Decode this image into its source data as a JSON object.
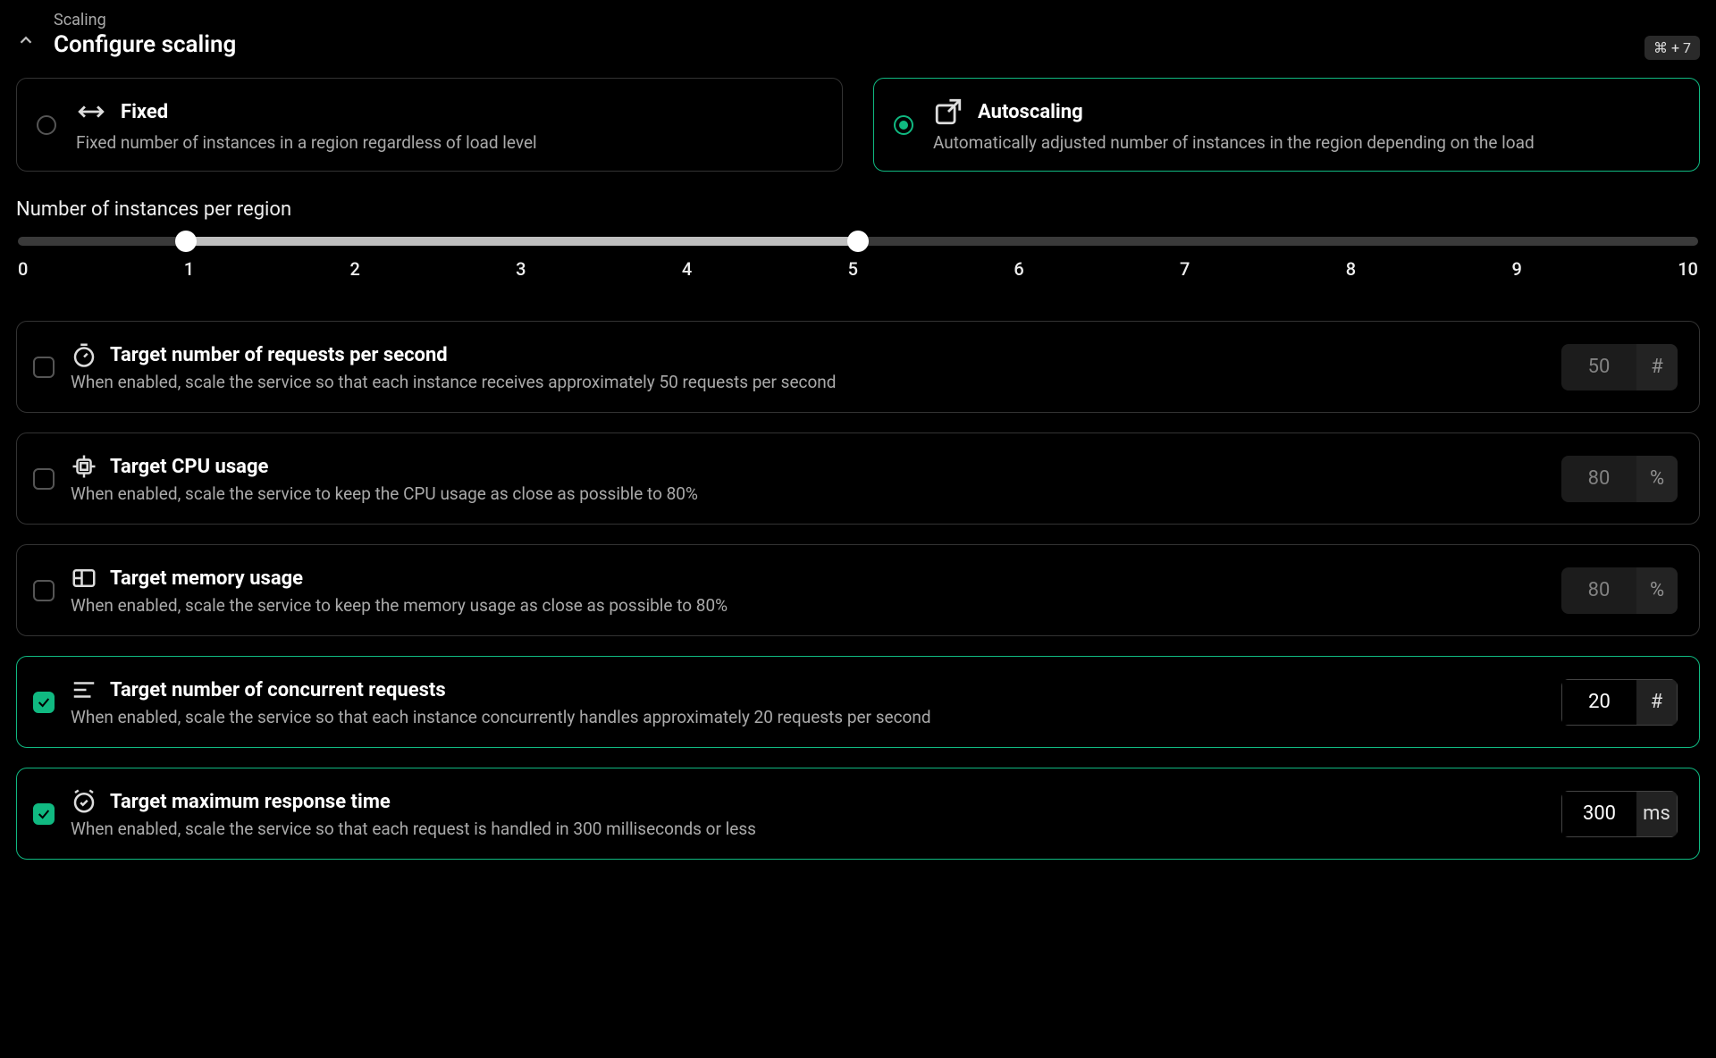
{
  "header": {
    "breadcrumb": "Scaling",
    "title": "Configure scaling",
    "shortcut": "⌘ + 7"
  },
  "modes": {
    "fixed": {
      "name": "Fixed",
      "desc": "Fixed number of instances in a region regardless of load level",
      "selected": false
    },
    "autoscaling": {
      "name": "Autoscaling",
      "desc": "Automatically adjusted number of instances in the region depending on the load",
      "selected": true
    }
  },
  "slider": {
    "label": "Number of instances per region",
    "min": 0,
    "max": 10,
    "low": 1,
    "high": 5,
    "ticks": [
      "0",
      "1",
      "2",
      "3",
      "4",
      "5",
      "6",
      "7",
      "8",
      "9",
      "10"
    ]
  },
  "metrics": [
    {
      "id": "rps",
      "name": "Target number of requests per second",
      "desc": "When enabled, scale the service so that each instance receives approximately 50 requests per second",
      "value": "50",
      "unit": "#",
      "enabled": false
    },
    {
      "id": "cpu",
      "name": "Target CPU usage",
      "desc": "When enabled, scale the service to keep the CPU usage as close as possible to 80%",
      "value": "80",
      "unit": "%",
      "enabled": false
    },
    {
      "id": "mem",
      "name": "Target memory usage",
      "desc": "When enabled, scale the service to keep the memory usage as close as possible to 80%",
      "value": "80",
      "unit": "%",
      "enabled": false
    },
    {
      "id": "conc",
      "name": "Target number of concurrent requests",
      "desc": "When enabled, scale the service so that each instance concurrently handles approximately 20 requests per second",
      "value": "20",
      "unit": "#",
      "enabled": true
    },
    {
      "id": "lat",
      "name": "Target maximum response time",
      "desc": "When enabled, scale the service so that each request is handled in 300 milliseconds or less",
      "value": "300",
      "unit": "ms",
      "enabled": true
    }
  ]
}
